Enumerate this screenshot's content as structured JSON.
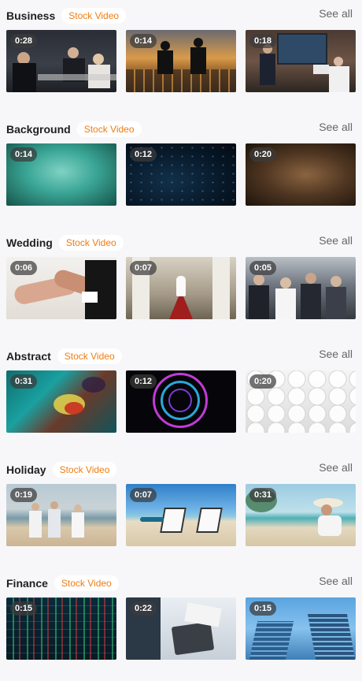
{
  "sections": [
    {
      "title": "Business",
      "tag": "Stock Video",
      "see_all": "See all",
      "videos": [
        {
          "duration": "0:28"
        },
        {
          "duration": "0:14"
        },
        {
          "duration": "0:18"
        }
      ]
    },
    {
      "title": "Background",
      "tag": "Stock Video",
      "see_all": "See all",
      "videos": [
        {
          "duration": "0:14"
        },
        {
          "duration": "0:12"
        },
        {
          "duration": "0:20"
        }
      ]
    },
    {
      "title": "Wedding",
      "tag": "Stock Video",
      "see_all": "See all",
      "videos": [
        {
          "duration": "0:06"
        },
        {
          "duration": "0:07"
        },
        {
          "duration": "0:05"
        }
      ]
    },
    {
      "title": "Abstract",
      "tag": "Stock Video",
      "see_all": "See all",
      "videos": [
        {
          "duration": "0:31"
        },
        {
          "duration": "0:12"
        },
        {
          "duration": "0:20"
        }
      ]
    },
    {
      "title": "Holiday",
      "tag": "Stock Video",
      "see_all": "See all",
      "videos": [
        {
          "duration": "0:19"
        },
        {
          "duration": "0:07"
        },
        {
          "duration": "0:31"
        }
      ]
    },
    {
      "title": "Finance",
      "tag": "Stock Video",
      "see_all": "See all",
      "videos": [
        {
          "duration": "0:15"
        },
        {
          "duration": "0:22"
        },
        {
          "duration": "0:15"
        }
      ]
    }
  ]
}
